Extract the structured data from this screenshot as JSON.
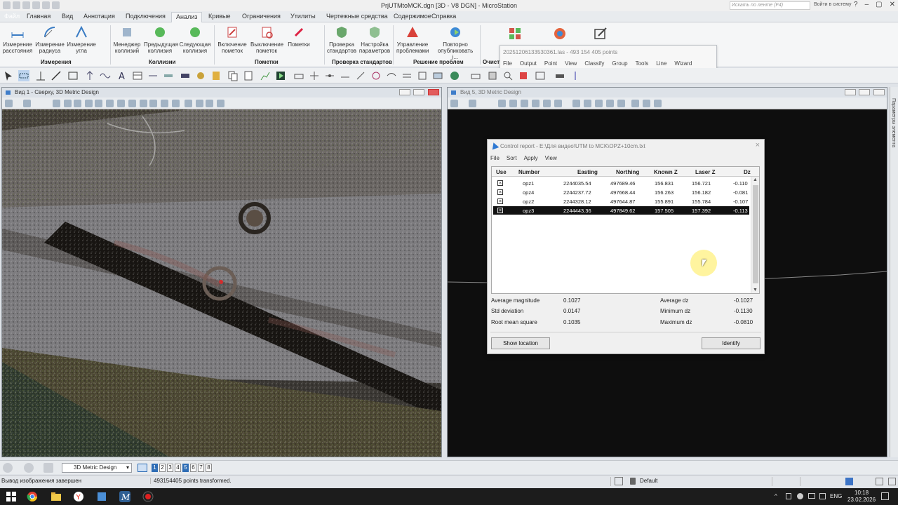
{
  "window": {
    "title": "PrjUTMtoMCK.dgn [3D - V8 DGN] - MicroStation",
    "search_placeholder": "Искать по ленте (F4)",
    "signin": "Войти в систему"
  },
  "tabs": [
    "Файл",
    "Главная",
    "Вид",
    "Аннотация",
    "Подключения",
    "Анализ",
    "Кривые",
    "Ограничения",
    "Утилиты",
    "Чертежные средства",
    "Содержимое",
    "Справка"
  ],
  "active_tab": "Анализ",
  "ribbon": {
    "groups": {
      "measure": "Измерения",
      "collisions": "Коллизии",
      "markups": "Пометки",
      "standards": "Проверка стандартов",
      "problems": "Решение проблем",
      "cleanup": "Очист"
    },
    "buttons": {
      "measure_distance": "Измерение расстояния",
      "measure_radius": "Измерение радиуса",
      "measure_angle": "Измерение угла",
      "collision_manager": "Менеджер коллизий",
      "prev_collision": "Предыдущая коллизия",
      "next_collision": "Следующая коллизия",
      "markups_on": "Включение пометок",
      "markups_off": "Выключение пометок",
      "markups": "Пометки",
      "check_standards": "Проверка стандартов",
      "standards_settings": "Настройка параметров",
      "manage_problems": "Управление проблемами",
      "republish": "Повторно опубликовать і..."
    }
  },
  "pointcloud_popup": {
    "file": "20251206133530361.las - 493 154 405 points",
    "menu": [
      "File",
      "Output",
      "Point",
      "View",
      "Classify",
      "Group",
      "Tools",
      "Line",
      "Wizard"
    ]
  },
  "view1": {
    "title": "Вид 1 - Сверху, 3D Metric Design"
  },
  "view5": {
    "title": "Вид 5, 3D Metric Design"
  },
  "right_panel": {
    "label": "Параметры элемента"
  },
  "dialog": {
    "title": "Control report - E:\\Для видео\\UTM to MCK\\OPZ+10cm.txt",
    "menu": [
      "File",
      "Sort",
      "Apply",
      "View"
    ],
    "columns": [
      "Use",
      "Number",
      "Easting",
      "Northing",
      "Known Z",
      "Laser Z",
      "Dz"
    ],
    "rows": [
      {
        "number": "opz1",
        "easting": "2244035.54",
        "northing": "497689.46",
        "known_z": "156.831",
        "laser_z": "156.721",
        "dz": "-0.110",
        "use": true,
        "selected": false
      },
      {
        "number": "opz4",
        "easting": "2244237.72",
        "northing": "497668.44",
        "known_z": "156.263",
        "laser_z": "156.182",
        "dz": "-0.081",
        "use": true,
        "selected": false
      },
      {
        "number": "opz2",
        "easting": "2244328.12",
        "northing": "497644.87",
        "known_z": "155.891",
        "laser_z": "155.784",
        "dz": "-0.107",
        "use": true,
        "selected": false
      },
      {
        "number": "opz3",
        "easting": "2244443.36",
        "northing": "497849.62",
        "known_z": "157.505",
        "laser_z": "157.392",
        "dz": "-0.113",
        "use": true,
        "selected": true
      }
    ],
    "stats": {
      "avg_mag_label": "Average magnitude",
      "avg_mag": "0.1027",
      "std_label": "Std deviation",
      "std": "0.0147",
      "rms_label": "Root mean square",
      "rms": "0.1035",
      "avg_dz_label": "Average dz",
      "avg_dz": "-0.1027",
      "min_dz_label": "Minimum dz",
      "min_dz": "-0.1130",
      "max_dz_label": "Maximum dz",
      "max_dz": "-0.0810"
    },
    "buttons": {
      "show_location": "Show location",
      "identify": "Identify"
    }
  },
  "bottombar": {
    "model": "3D Metric Design",
    "views": [
      "1",
      "2",
      "3",
      "4",
      "5",
      "6",
      "7",
      "8"
    ],
    "active_views": [
      "1",
      "5"
    ]
  },
  "status": {
    "left": "Вывод изображения завершен",
    "message": "493154405 points transformed.",
    "level": "Default"
  },
  "taskbar": {
    "lang": "ENG",
    "time": "10:18",
    "date": "23.02.2026"
  }
}
